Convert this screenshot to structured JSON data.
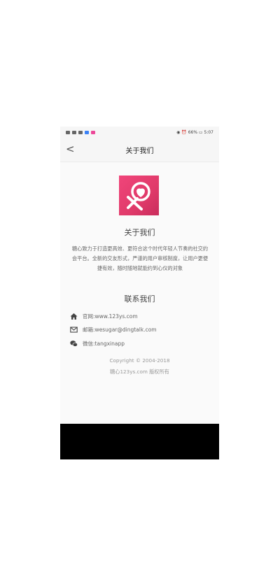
{
  "statusbar": {
    "battery_time": "◉ ⏰ 66% ▭ 5:07"
  },
  "navbar": {
    "back_glyph": "<",
    "title": "关于我们"
  },
  "about": {
    "heading": "关于我们",
    "description": "糖心致力于打造更高效、更符合这个时代年轻人节奏的社交约会平台。全新的交友形式，严谨的用户审核制度，让用户更便捷有效，随时随地就能约到心仪的对象"
  },
  "contact": {
    "heading": "联系我们",
    "website": "官网:www.123ys.com",
    "email": "邮箱:wesugar@dingtalk.com",
    "wechat": "微信:tangxinapp"
  },
  "footer": {
    "copyright": "Copyright © 2004-2018",
    "rights": "糖心123ys.com 版权所有"
  },
  "colors": {
    "brand": "#e8406f",
    "overlay": "#000000"
  }
}
